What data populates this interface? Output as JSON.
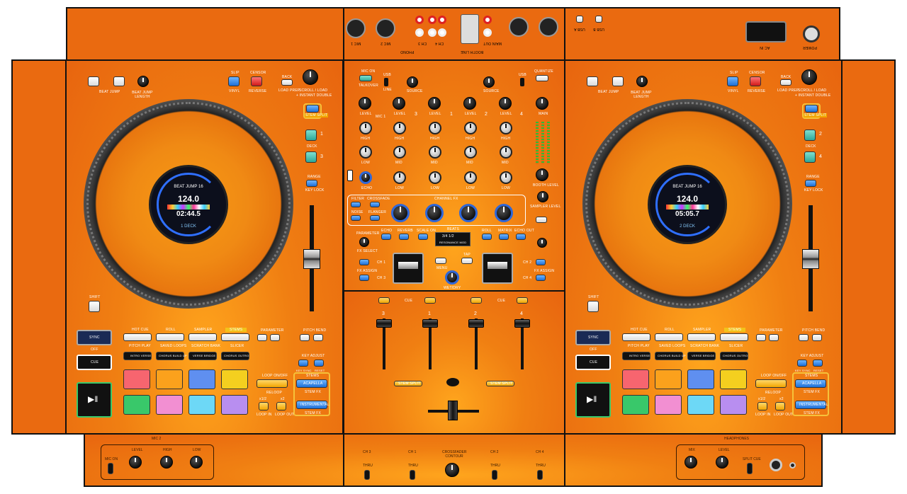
{
  "rear": {
    "mic1": "MIC 1",
    "mic2": "MIC 2",
    "ch3": "CH 3",
    "ch4": "CH 4",
    "phono": "PHONO",
    "booth": "BOOTH LINE",
    "main_out": "MAIN OUT",
    "usb_a": "USB A",
    "usb_b": "USB B",
    "ac_in": "AC IN",
    "power": "POWER"
  },
  "decks": {
    "left": {
      "beat_jump": "BEAT JUMP",
      "beat_jump_length": "BEAT JUMP LENGTH",
      "slip": "SLIP",
      "vinyl": "VINYL",
      "censor": "CENSOR",
      "reverse": "REVERSE",
      "back": "BACK",
      "load_prep": "LOAD PREP",
      "scroll_load": "SCROLL / LOAD",
      "instant_double": "+ INSTANT DOUBLE",
      "stem_split": "STEM SPLIT",
      "deck": "DECK",
      "deck_a": "1",
      "deck_b": "3",
      "range": "RANGE",
      "key_lock": "KEY LOCK",
      "shift": "SHIFT",
      "screen": {
        "mode": "BEAT JUMP 16",
        "bpm": "124.0",
        "time": "02:44.5",
        "deck": "1  DECK"
      },
      "sync": "SYNC",
      "off": "OFF",
      "cue": "CUE",
      "modes": [
        "HOT CUE",
        "ROLL",
        "SAMPLER",
        "STEMS"
      ],
      "submodes": [
        "PITCH PLAY",
        "SAVED LOOPS",
        "SCRATCH BANK",
        "SLICER"
      ],
      "stem_bar": [
        "INTRO VERSE",
        "CHORUS BUILD UP",
        "VERSE BRIDGE",
        "CHORUS OUTRO"
      ],
      "parameter": "PARAMETER",
      "pitch_bend": "PITCH BEND",
      "key_adjust": "KEY ADJUST",
      "key_sync": "KEY SYNC",
      "reset": "RESET",
      "loop_on_off": "LOOP ON/OFF",
      "reloop": "RELOOP",
      "half": "x1/2",
      "double": "x2",
      "loop_in": "LOOP IN",
      "loop_out": "LOOP OUT",
      "stems": "STEMS",
      "acapella": "ACAPELLA",
      "instrumental": "INSTRUMENTAL",
      "stem_fx": "STEM FX"
    },
    "right": {
      "screen": {
        "mode": "BEAT JUMP 16",
        "bpm": "124.0",
        "time": "05:05.7",
        "deck": "2  DECK"
      },
      "deck_a": "2",
      "deck_b": "4"
    }
  },
  "mixer": {
    "mic_on": "MIC ON",
    "talkover": "TALKOVER",
    "usb": "USB",
    "line": "LINE",
    "source": "SOURCE",
    "gain": "GAIN",
    "level": "LEVEL",
    "mic1": "MIC 1",
    "high": "HIGH",
    "mid": "MID",
    "low": "LOW",
    "echo": "ECHO",
    "quantize": "QUANTIZE",
    "main": "MAIN",
    "booth": "BOOTH LEVEL",
    "sampler_level": "SAMPLER LEVEL",
    "cue": "CUE",
    "ch_labels": [
      "3",
      "1",
      "2",
      "4"
    ],
    "filter": "FILTER",
    "crossfade": "CROSSFADE",
    "noise": "NOISE",
    "flanger": "FLANGER",
    "channel_fx": "CHANNEL FX",
    "fx_row": [
      "ECHO",
      "REVERB",
      "SCALE ON",
      "ROLL",
      "MATRIX",
      "ECHO OUT"
    ],
    "beats": "BEATS",
    "display": {
      "line1": "3/4  1/2",
      "line2": "RESONANCE MOD"
    },
    "parameter": "PARAMETER",
    "fx_select": "FX SELECT",
    "fx_assign": "FX ASSIGN",
    "ch1": "CH 1",
    "ch2": "CH 2",
    "ch3": "CH 3",
    "ch4": "CH 4",
    "tap": "TAP",
    "menu": "MENU",
    "wet_dry": "WET/DRY",
    "fader_labels": [
      "3",
      "1",
      "2",
      "4"
    ],
    "stem_split": "STEM SPLIT"
  },
  "front": {
    "mic2": "MIC 2",
    "mic_on": "MIC ON",
    "level": "LEVEL",
    "high": "HIGH",
    "low": "LOW",
    "ch3": "CH 3",
    "ch1": "CH 1",
    "crossfader_contour": "CROSSFADER CONTOUR",
    "ch2": "CH 2",
    "ch4": "CH 4",
    "thru": "THRU",
    "headphones": "HEADPHONES",
    "mix": "MIX",
    "split_cue": "SPLIT CUE"
  },
  "colors": {
    "body": "#ea6a10",
    "accent_blue": "#2f67d8",
    "pad_row1": [
      "#f7656f",
      "#fba11c",
      "#5f8ff0",
      "#f4cf1f"
    ],
    "pad_row2": [
      "#39c86a",
      "#f28fd2",
      "#6dd8f6",
      "#b88ef0"
    ]
  }
}
